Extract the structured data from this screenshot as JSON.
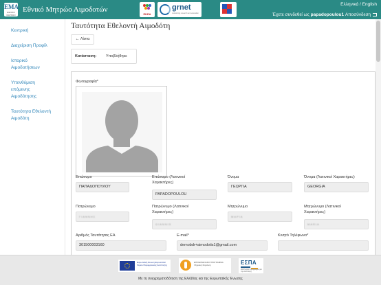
{
  "header": {
    "logo_text": "ΕΜΑ",
    "logo_sub": "ΕΘΝΙΚΟ ΜΗΤΡΩΟ",
    "site_title": "Εθνικό Μητρώο Αιμοδοτών",
    "partner1_label": "ΕΚΕΑ",
    "grnet_label": "grnet",
    "grnet_sub": "networking research and education",
    "lang_el": "Ελληνικά",
    "lang_sep": " / ",
    "lang_en": "English",
    "logged_in_prefix": "Έχετε συνδεθεί ως",
    "username": "papadopoulou1",
    "logout_label": "Αποσύνδεση",
    "header_color": "#2a8a85"
  },
  "sidebar": {
    "items": [
      {
        "label": "Κεντρική"
      },
      {
        "label": "Διαχείριση Προφίλ"
      },
      {
        "label": "Ιστορικό"
      },
      {
        "label": "Αιμοδοτήσεων"
      },
      {
        "label": "Υπενθύμιση"
      },
      {
        "label": "επόμενης"
      },
      {
        "label": "Αιμοδότησης"
      },
      {
        "label": "Ταυτότητα Εθελοντή"
      },
      {
        "label": "Αιμοδότη"
      }
    ],
    "link_color": "#2d84b8"
  },
  "main": {
    "title": "Ταυτότητα Εθελοντή Αιμοδότη",
    "back_label": "Λίστα",
    "status_key": "Κατάσταση:",
    "status_value": "Υποβλήθηκε",
    "photo_label": "Φωτογραφία*",
    "fields": {
      "surname": {
        "label": "Επώνυμο",
        "value": "ΠΑΠΑΔΟΠΟΥΛΟΥ"
      },
      "surname_latin": {
        "label1": "Επώνυμο (Λατινικοί",
        "label2": "Χαρακτήρες)",
        "value": "PAPADOPOULOU"
      },
      "name": {
        "label": "Όνομα",
        "value": "ΓΕΩΡΓΙΑ"
      },
      "name_latin": {
        "label": "Όνομα (Λατινικοί Χαρακτήρες)",
        "value": "GEORGIA"
      },
      "father": {
        "label": "Πατρώνυμο",
        "value": "ΓΙΑΝΝΗΣ"
      },
      "father_latin": {
        "label1": "Πατρώνυμο (Λατινικοί",
        "label2": "Χαρακτήρες)",
        "value": "GIANNIS"
      },
      "mother": {
        "label": "Μητρώνυμο",
        "value": "ΜΑΡΙΑ"
      },
      "mother_latin": {
        "label1": "Μητρώνυμο (Λατινικοί",
        "label2": "Χαρακτήρες)",
        "value": "MARIA"
      },
      "id_number": {
        "label": "Αριθμός Ταυτότητας ΕΑ",
        "value": "301500003160"
      },
      "email": {
        "label": "E-mail*",
        "value": "demobdr+aimodotis1@gmail.com"
      },
      "phone": {
        "label": "Κινητό Τηλέφωνο*",
        "value": ""
      }
    }
  },
  "footer": {
    "eu_text": "Ευρωπαϊκή Ένωση Ευρωπαϊκό Ταμείο Περιφερειακής Ανάπτυξης",
    "ep_text": "ΕΠΙΧΕΙΡΗΣΙΑΚΟ ΠΡΟΓΡΑΜΜΑ Ψηφιακή Σύγκλιση",
    "espa_text": "ΕΣΠΑ",
    "espa_sub": "2007-2013 πρόγραμμα για την ανάπτυξη",
    "cofinance_text": "Με τη συγχρηματοδότηση της Ελλάδας και της Ευρωπαϊκής Ένωσης"
  }
}
